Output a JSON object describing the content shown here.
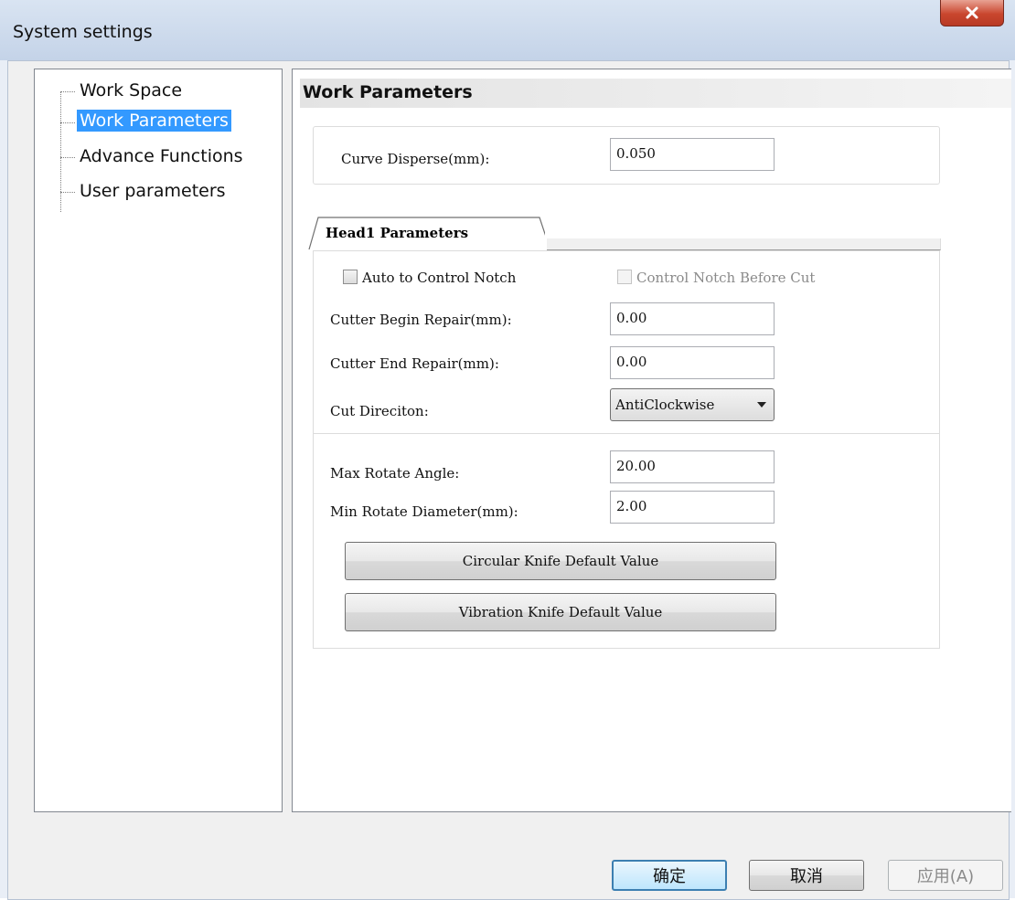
{
  "window": {
    "title": "System settings"
  },
  "tree": {
    "items": [
      {
        "label": "Work Space",
        "selected": false
      },
      {
        "label": "Work Parameters",
        "selected": true
      },
      {
        "label": "Advance Functions",
        "selected": false
      },
      {
        "label": "User parameters",
        "selected": false
      }
    ]
  },
  "main": {
    "section_title": "Work Parameters",
    "curve_disperse_label": "Curve Disperse(mm):",
    "curve_disperse_value": "0.050",
    "tab_label": "Head1 Parameters",
    "auto_control_notch_label": "Auto to Control Notch",
    "auto_control_notch_checked": false,
    "control_notch_before_cut_label": "Control Notch Before Cut",
    "control_notch_before_cut_checked": false,
    "cutter_begin_repair_label": "Cutter Begin Repair(mm):",
    "cutter_begin_repair_value": "0.00",
    "cutter_end_repair_label": "Cutter End Repair(mm):",
    "cutter_end_repair_value": "0.00",
    "cut_direction_label": "Cut Direciton:",
    "cut_direction_value": "AntiClockwise",
    "max_rotate_angle_label": "Max Rotate Angle:",
    "max_rotate_angle_value": "20.00",
    "min_rotate_diameter_label": "Min Rotate Diameter(mm):",
    "min_rotate_diameter_value": "2.00",
    "circular_knife_button": "Circular Knife Default Value",
    "vibration_knife_button": "Vibration Knife Default Value"
  },
  "footer": {
    "ok_label": "确定",
    "cancel_label": "取消",
    "apply_label": "应用(A)"
  },
  "colors": {
    "selection": "#3399ff",
    "close_button": "#c9462e"
  }
}
